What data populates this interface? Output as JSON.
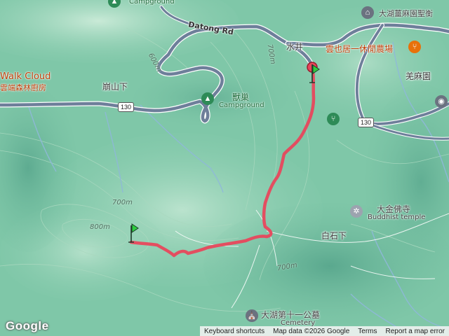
{
  "places": {
    "shuijing": "水井",
    "bengshanxia": "崩山下",
    "qianmayuan": "羌麻園",
    "baishixia": "白石下"
  },
  "pois": {
    "campground_top": "Campground",
    "dahu_temple": "大湖薑麻園聖衡",
    "farm": "雲也居一休閒農場",
    "walk_cloud": "Walk Cloud",
    "walk_cloud_sub": "雲端森林廚房",
    "shouchao": "獸巢",
    "shouchao_sub": "Campground",
    "dajin_temple": "大金佛寺",
    "dajin_temple_sub": "Buddhist temple",
    "cemetery": "大湖第十一公墓",
    "cemetery_sub": "Cemetery"
  },
  "roads": {
    "datong": "Datong Rd",
    "shield_130_a": "130",
    "shield_130_b": "130"
  },
  "contours": {
    "c600": "600m",
    "c700_top": "700m",
    "c700_left": "700m",
    "c800": "800m",
    "c700_bottom": "700m"
  },
  "icons": {
    "campground": "campground-icon",
    "temple": "temple-icon",
    "restaurant": "restaurant-icon",
    "trail_start": "flag-marker-icon",
    "trail_end": "flag-marker-icon",
    "buddhist": "dharma-wheel-icon",
    "cemetery": "cemetery-icon"
  },
  "colors": {
    "track": "#e8475c",
    "terrain": "#7fc7a8",
    "road": "#6e7f9a",
    "poi_green": "#2e8b57",
    "poi_orange": "#e8710a"
  },
  "footer": {
    "shortcuts": "Keyboard shortcuts",
    "mapdata": "Map data ©2026 Google",
    "terms": "Terms",
    "report": "Report a map error"
  },
  "branding": "Google"
}
